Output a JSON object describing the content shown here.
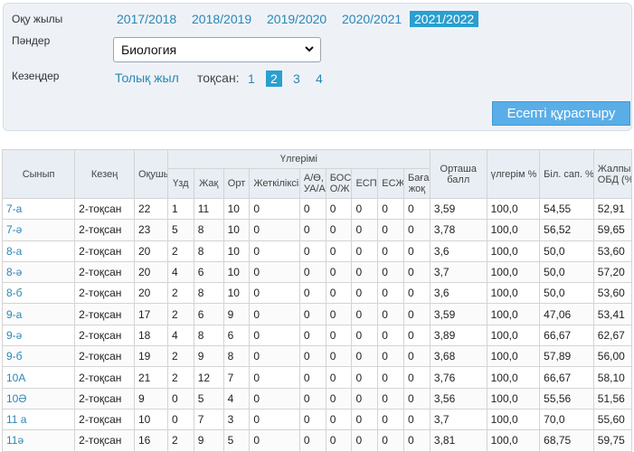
{
  "filters": {
    "year_label": "Оқу жылы",
    "years": [
      "2017/2018",
      "2018/2019",
      "2019/2020",
      "2020/2021",
      "2021/2022"
    ],
    "subject_label": "Пәндер",
    "subject_value": "Биология",
    "period_label": "Кезеңдер",
    "full_year": "Толық жыл",
    "quarter_label": "тоқсан:",
    "quarters": [
      "1",
      "2",
      "3",
      "4"
    ],
    "build_button": "Есепті құрастыру"
  },
  "table": {
    "headers": {
      "class": "Сынып",
      "period": "Кезең",
      "students": "Оқушы",
      "progress_group": "Үлгерімі",
      "excellent": "Үзд",
      "good": "Жақ",
      "average": "Орт",
      "insufficient": "Жеткіліксіз",
      "ao_l1": "А/Ө,",
      "ao_l2": "УА/А",
      "bos_l1": "БОС-",
      "bos_l2": "О/Ж",
      "esp": "ЕСП",
      "eszh": "ЕСЖ",
      "notgraded_l1": "Баға",
      "notgraded_l2": "жоқ",
      "avg_l1": "Орташа",
      "avg_l2": "балл",
      "progress_pct": "үлгерім %",
      "quality_pct": "Біл. сап. %",
      "obd_l1": "Жалпы",
      "obd_l2": "ОБД (%)"
    },
    "rows": [
      [
        "7-а",
        "2-тоқсан",
        "22",
        "1",
        "11",
        "10",
        "0",
        "0",
        "0",
        "0",
        "0",
        "0",
        "3,59",
        "100,0",
        "54,55",
        "52,91"
      ],
      [
        "7-ә",
        "2-тоқсан",
        "23",
        "5",
        "8",
        "10",
        "0",
        "0",
        "0",
        "0",
        "0",
        "0",
        "3,78",
        "100,0",
        "56,52",
        "59,65"
      ],
      [
        "8-а",
        "2-тоқсан",
        "20",
        "2",
        "8",
        "10",
        "0",
        "0",
        "0",
        "0",
        "0",
        "0",
        "3,6",
        "100,0",
        "50,0",
        "53,60"
      ],
      [
        "8-ә",
        "2-тоқсан",
        "20",
        "4",
        "6",
        "10",
        "0",
        "0",
        "0",
        "0",
        "0",
        "0",
        "3,7",
        "100,0",
        "50,0",
        "57,20"
      ],
      [
        "8-б",
        "2-тоқсан",
        "20",
        "2",
        "8",
        "10",
        "0",
        "0",
        "0",
        "0",
        "0",
        "0",
        "3,6",
        "100,0",
        "50,0",
        "53,60"
      ],
      [
        "9-а",
        "2-тоқсан",
        "17",
        "2",
        "6",
        "9",
        "0",
        "0",
        "0",
        "0",
        "0",
        "0",
        "3,59",
        "100,0",
        "47,06",
        "53,41"
      ],
      [
        "9-ә",
        "2-тоқсан",
        "18",
        "4",
        "8",
        "6",
        "0",
        "0",
        "0",
        "0",
        "0",
        "0",
        "3,89",
        "100,0",
        "66,67",
        "62,67"
      ],
      [
        "9-б",
        "2-тоқсан",
        "19",
        "2",
        "9",
        "8",
        "0",
        "0",
        "0",
        "0",
        "0",
        "0",
        "3,68",
        "100,0",
        "57,89",
        "56,00"
      ],
      [
        "10А",
        "2-тоқсан",
        "21",
        "2",
        "12",
        "7",
        "0",
        "0",
        "0",
        "0",
        "0",
        "0",
        "3,76",
        "100,0",
        "66,67",
        "58,10"
      ],
      [
        "10Ә",
        "2-тоқсан",
        "9",
        "0",
        "5",
        "4",
        "0",
        "0",
        "0",
        "0",
        "0",
        "0",
        "3,56",
        "100,0",
        "55,56",
        "51,56"
      ],
      [
        "11 а",
        "2-тоқсан",
        "10",
        "0",
        "7",
        "3",
        "0",
        "0",
        "0",
        "0",
        "0",
        "0",
        "3,7",
        "100,0",
        "70,0",
        "55,60"
      ],
      [
        "11ә",
        "2-тоқсан",
        "16",
        "2",
        "9",
        "5",
        "0",
        "0",
        "0",
        "0",
        "0",
        "0",
        "3,81",
        "100,0",
        "68,75",
        "59,75"
      ]
    ]
  }
}
